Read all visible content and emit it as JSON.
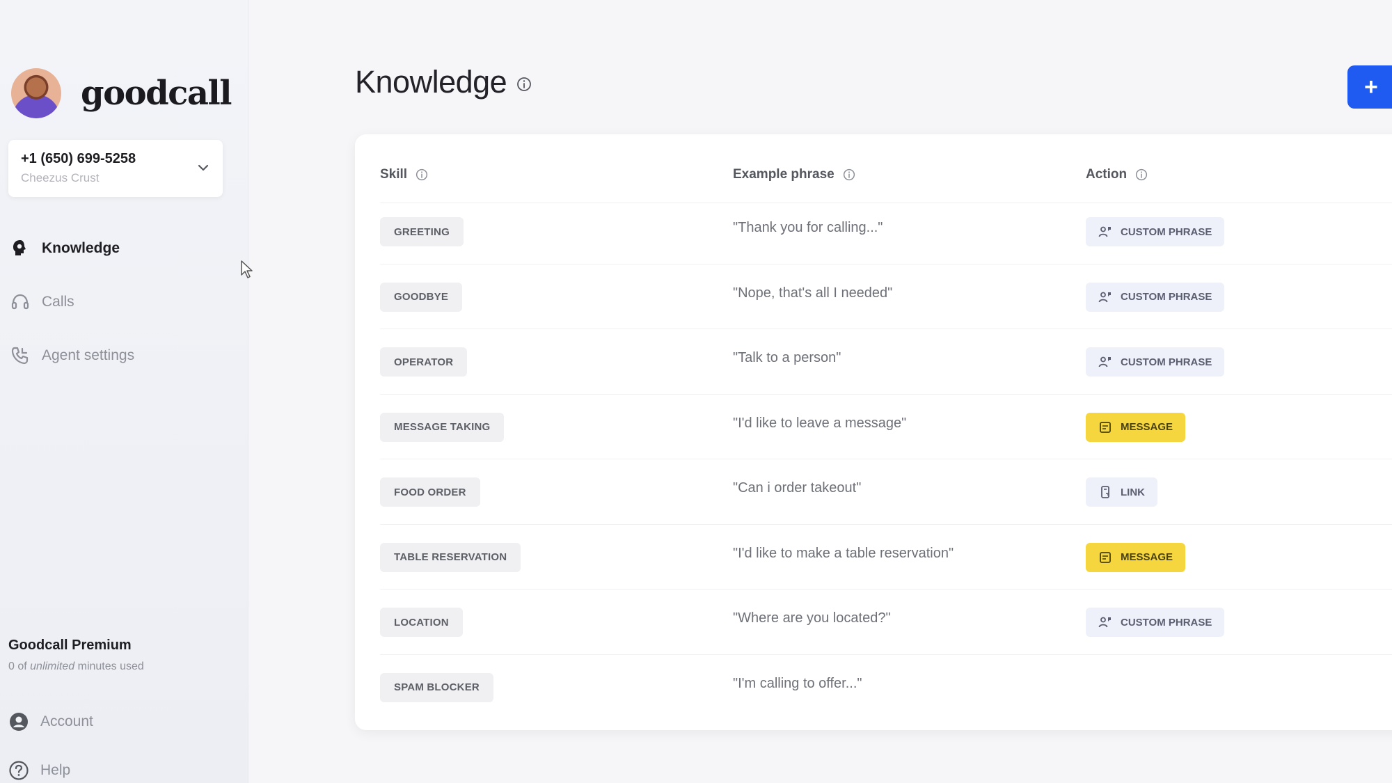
{
  "brand": {
    "logo_text": "goodcall"
  },
  "phone_selector": {
    "number": "+1 (650) 699-5258",
    "business": "Cheezus Crust"
  },
  "nav": [
    {
      "label": "Knowledge",
      "icon": "brain-head-icon",
      "active": true
    },
    {
      "label": "Calls",
      "icon": "headset-icon",
      "active": false
    },
    {
      "label": "Agent settings",
      "icon": "phone-settings-icon",
      "active": false
    }
  ],
  "plan": {
    "title": "Goodcall Premium",
    "usage_prefix": "0 of ",
    "usage_emphasis": "unlimited",
    "usage_suffix": " minutes used"
  },
  "bottom_nav": [
    {
      "label": "Account",
      "icon": "account-icon"
    },
    {
      "label": "Help",
      "icon": "help-icon"
    }
  ],
  "page": {
    "title": "Knowledge",
    "add_button_label": "+"
  },
  "table": {
    "headers": {
      "skill": "Skill",
      "phrase": "Example phrase",
      "action": "Action"
    },
    "rows": [
      {
        "skill": "GREETING",
        "phrase": "\"Thank you for calling...\"",
        "action": "CUSTOM PHRASE",
        "action_type": "custom"
      },
      {
        "skill": "GOODBYE",
        "phrase": "\"Nope, that's all I needed\"",
        "action": "CUSTOM PHRASE",
        "action_type": "custom"
      },
      {
        "skill": "OPERATOR",
        "phrase": "\"Talk to a person\"",
        "action": "CUSTOM PHRASE",
        "action_type": "custom"
      },
      {
        "skill": "MESSAGE TAKING",
        "phrase": "\"I'd like to leave a message\"",
        "action": "MESSAGE",
        "action_type": "message"
      },
      {
        "skill": "FOOD ORDER",
        "phrase": "\"Can i order takeout\"",
        "action": "LINK",
        "action_type": "link"
      },
      {
        "skill": "TABLE RESERVATION",
        "phrase": "\"I'd like to make a table reservation\"",
        "action": "MESSAGE",
        "action_type": "message"
      },
      {
        "skill": "LOCATION",
        "phrase": "\"Where are you located?\"",
        "action": "CUSTOM PHRASE",
        "action_type": "custom"
      },
      {
        "skill": "SPAM BLOCKER",
        "phrase": "\"I'm calling to offer...\"",
        "action": "",
        "action_type": "none"
      }
    ]
  },
  "colors": {
    "accent": "#1f5bf0",
    "message_chip": "#f5d63f",
    "custom_chip": "#eef1f9"
  }
}
